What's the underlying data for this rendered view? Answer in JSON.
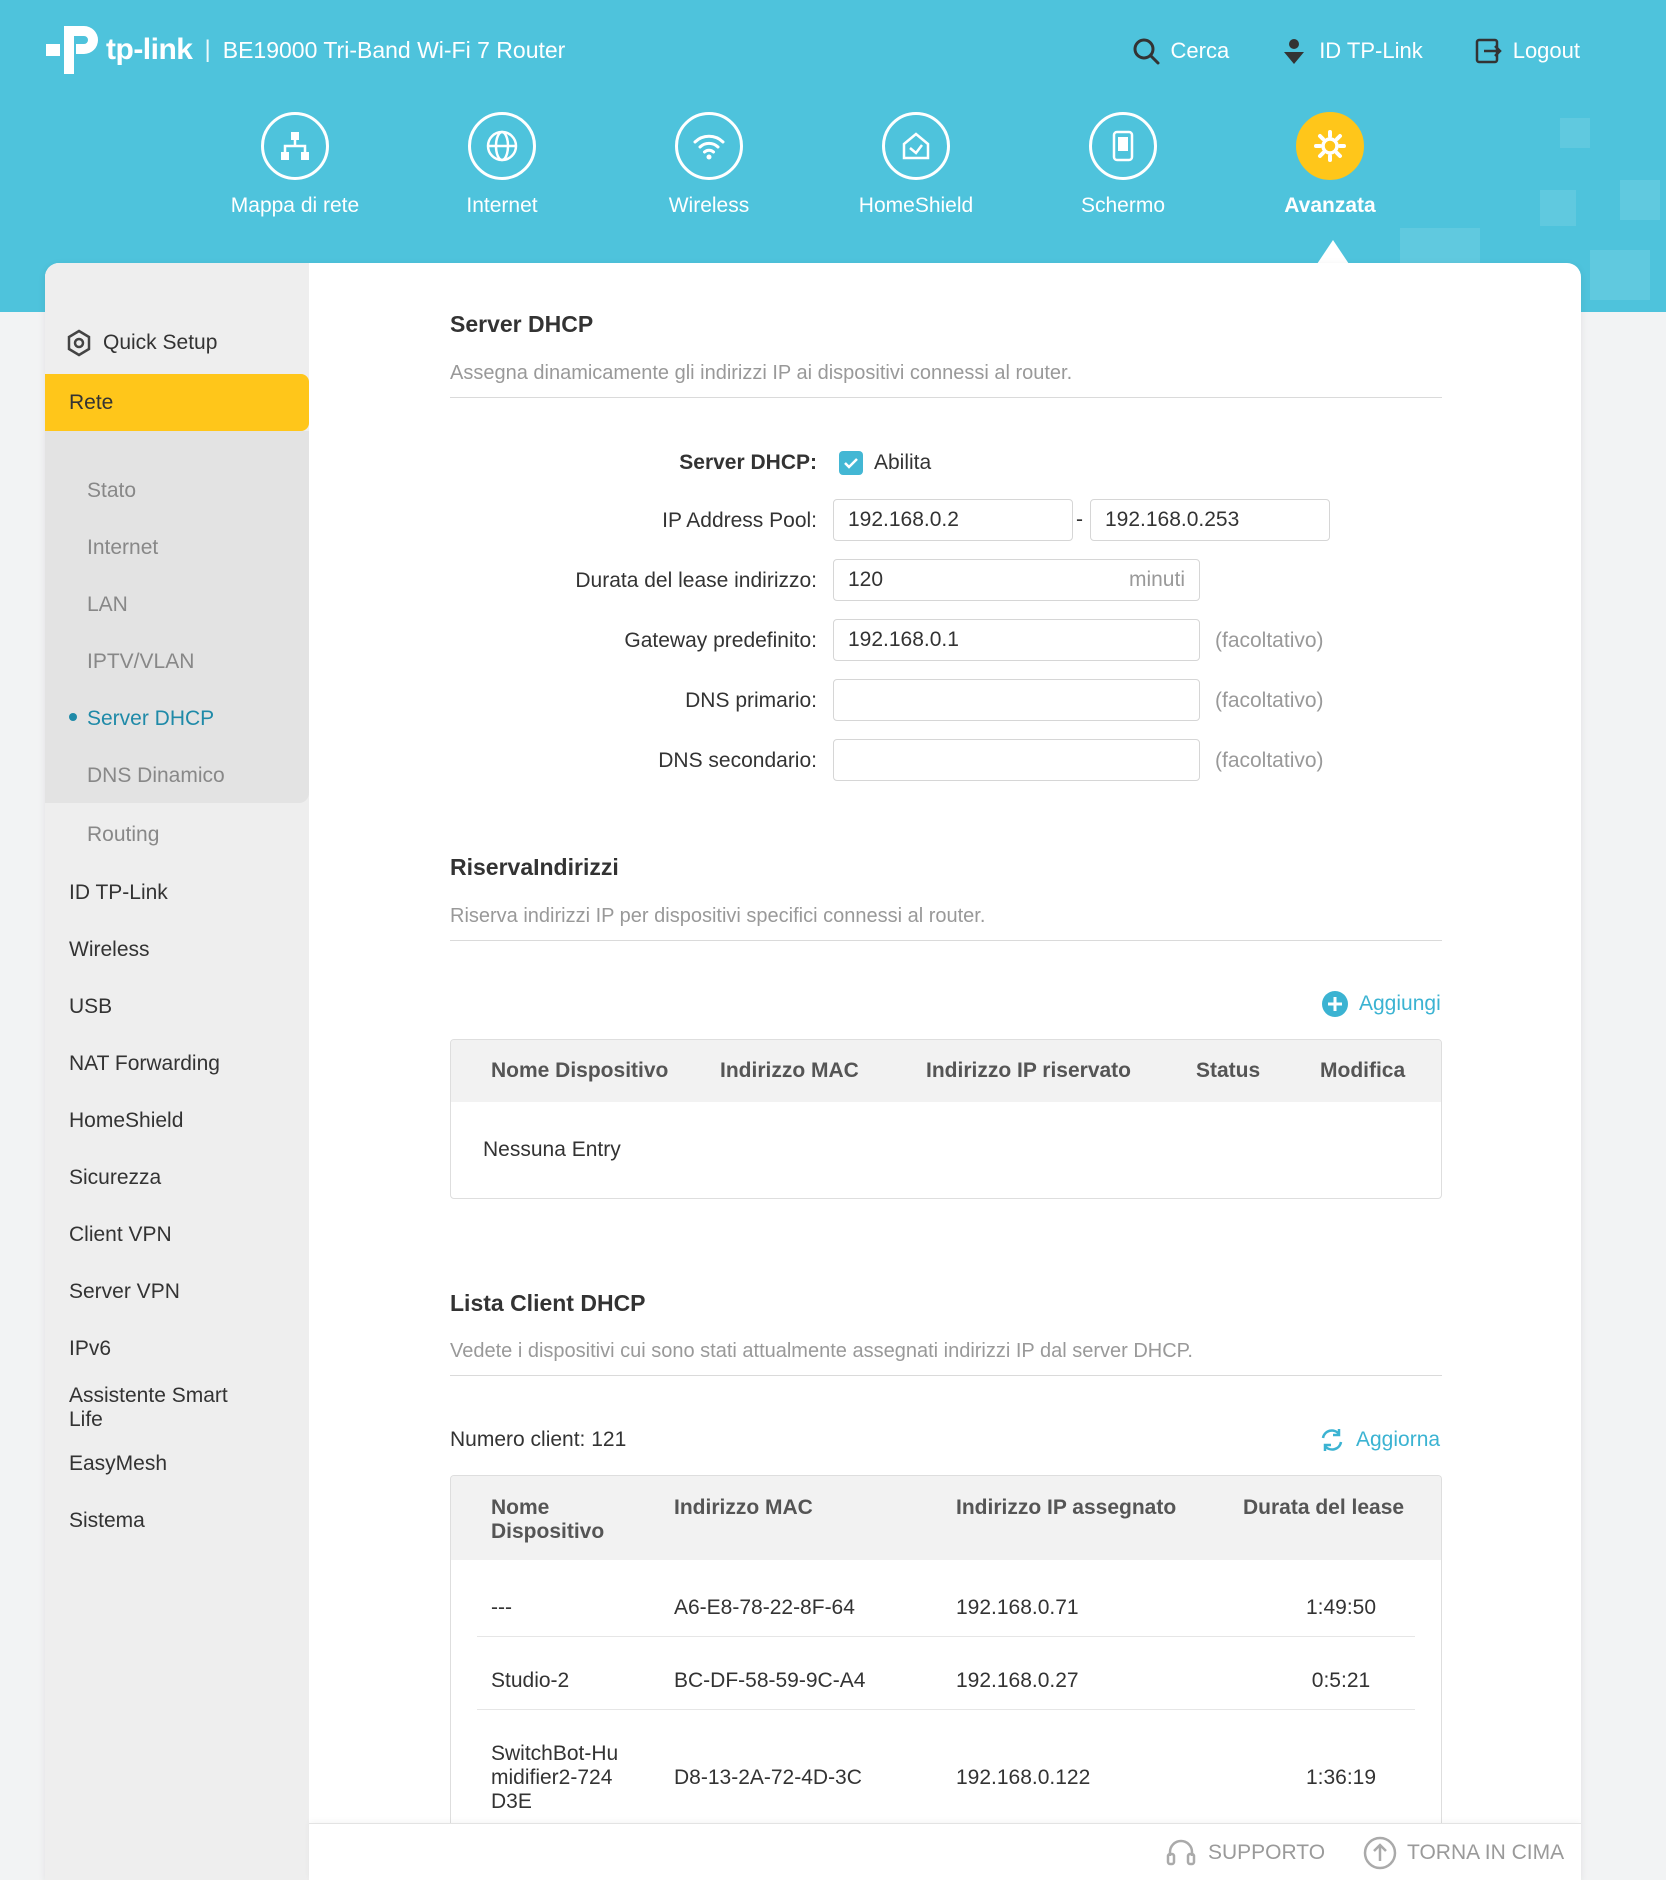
{
  "header": {
    "brand": "tp-link",
    "separator": "|",
    "model": "BE19000 Tri-Band Wi-Fi 7 Router",
    "links": {
      "search": "Cerca",
      "id": "ID TP-Link",
      "logout": "Logout"
    },
    "nav": [
      {
        "label": "Mappa di rete",
        "icon": "network-map-icon"
      },
      {
        "label": "Internet",
        "icon": "globe-icon"
      },
      {
        "label": "Wireless",
        "icon": "wifi-icon"
      },
      {
        "label": "HomeShield",
        "icon": "homeshield-icon"
      },
      {
        "label": "Schermo",
        "icon": "screen-icon"
      },
      {
        "label": "Avanzata",
        "icon": "gear-icon",
        "active": true
      }
    ]
  },
  "sidebar": {
    "quick_setup": "Quick Setup",
    "group": "Rete",
    "sub_items": [
      "Stato",
      "Internet",
      "LAN",
      "IPTV/VLAN",
      "Server DHCP",
      "DNS Dinamico",
      "Routing"
    ],
    "active_sub": "Server DHCP",
    "items": [
      "ID TP-Link",
      "Wireless",
      "USB",
      "NAT Forwarding",
      "HomeShield",
      "Sicurezza",
      "Client VPN",
      "Server VPN",
      "IPv6",
      "Assistente Smart Life",
      "EasyMesh",
      "Sistema"
    ]
  },
  "dhcp": {
    "title": "Server DHCP",
    "desc": "Assegna dinamicamente gli indirizzi IP ai dispositivi connessi al router.",
    "enable_label": "Server DHCP:",
    "enable_text": "Abilita",
    "enabled": true,
    "pool_label": "IP Address Pool:",
    "pool_start": "192.168.0.2",
    "pool_dash": "-",
    "pool_end": "192.168.0.253",
    "lease_label": "Durata del lease indirizzo:",
    "lease_value": "120",
    "lease_unit": "minuti",
    "gateway_label": "Gateway predefinito:",
    "gateway_value": "192.168.0.1",
    "dns1_label": "DNS primario:",
    "dns1_value": "",
    "dns2_label": "DNS secondario:",
    "dns2_value": "",
    "optional": "(facoltativo)"
  },
  "reservation": {
    "title": "RiservaIndirizzi",
    "desc": "Riserva indirizzi IP per dispositivi specifici connessi al router.",
    "add": "Aggiungi",
    "columns": [
      "Nome Dispositivo",
      "Indirizzo MAC",
      "Indirizzo IP riservato",
      "Status",
      "Modifica"
    ],
    "empty": "Nessuna Entry"
  },
  "clients": {
    "title": "Lista Client DHCP",
    "desc": "Vedete i dispositivi cui sono stati attualmente assegnati indirizzi IP dal server DHCP.",
    "count": "Numero client: 121",
    "refresh": "Aggiorna",
    "columns": [
      "Nome Dispositivo",
      "Indirizzo MAC",
      "Indirizzo IP assegnato",
      "Durata del lease"
    ],
    "rows": [
      {
        "name": "---",
        "mac": "A6-E8-78-22-8F-64",
        "ip": "192.168.0.71",
        "lease": "1:49:50"
      },
      {
        "name": "Studio-2",
        "mac": "BC-DF-58-59-9C-A4",
        "ip": "192.168.0.27",
        "lease": "0:5:21"
      },
      {
        "name": "SwitchBot-Humidifier2-724D3E",
        "mac": "D8-13-2A-72-4D-3C",
        "ip": "192.168.0.122",
        "lease": "1:36:19"
      }
    ]
  },
  "footer": {
    "support": "SUPPORTO",
    "top": "TORNA IN CIMA"
  },
  "colors": {
    "header": "#4ec3dc",
    "accent": "#ffc61a",
    "link": "#3bb3d2",
    "active_sub": "#1f8aa8"
  }
}
